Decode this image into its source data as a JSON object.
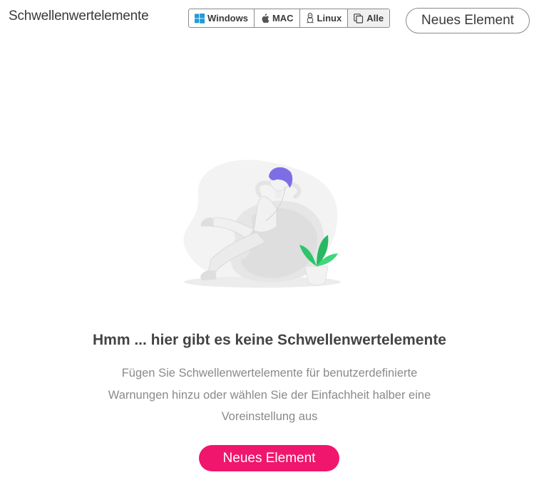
{
  "header": {
    "title": "Schwellenwertelemente",
    "new_button_label": "Neues Element"
  },
  "os_filter": {
    "items": [
      {
        "label": "Windows",
        "icon": "windows-icon",
        "icon_color": "#1e9bd7"
      },
      {
        "label": "MAC",
        "icon": "apple-icon"
      },
      {
        "label": "Linux",
        "icon": "linux-icon"
      },
      {
        "label": "Alle",
        "icon": "copy-icon"
      }
    ],
    "selected": "Alle"
  },
  "empty_state": {
    "illustration": "person-relaxing-on-beanbag",
    "title": "Hmm ... hier gibt es keine Schwellenwertelemente",
    "description": "Fügen Sie Schwellenwertelemente für benutzerdefinierte Warnungen hinzu oder wählen Sie der Einfachheit halber eine Voreinstellung aus",
    "button_label": "Neues Element"
  },
  "colors": {
    "accent": "#f0166d",
    "text": "#3a3a3a",
    "muted": "#8a8a8a"
  }
}
